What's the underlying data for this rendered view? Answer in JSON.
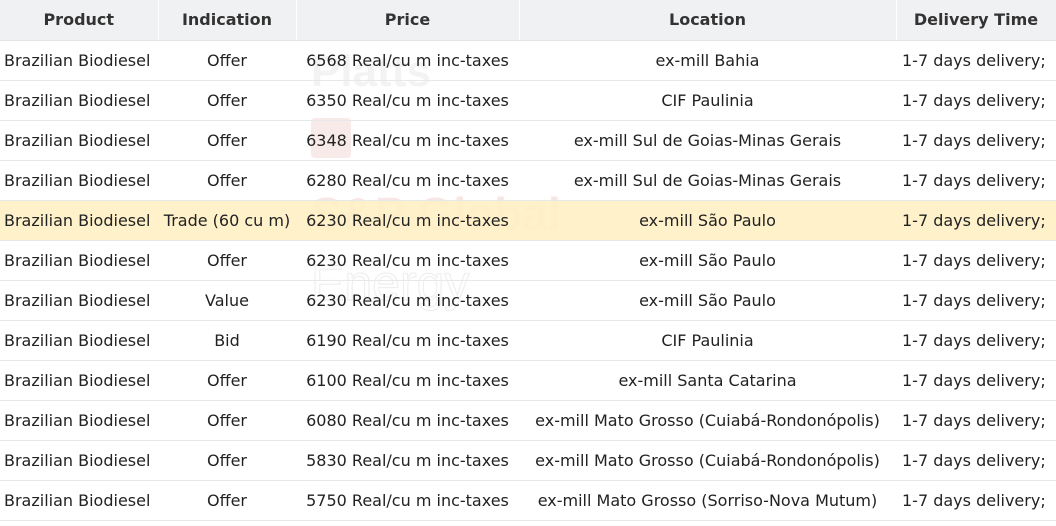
{
  "watermark": {
    "line1": "Platts",
    "line2": "S&P Global",
    "line3": "Energy"
  },
  "colors": {
    "header_bg": "#f0f1f3",
    "highlight_row": "#fff0c4",
    "row_border": "#e6e8ea"
  },
  "table": {
    "headers": [
      "Product",
      "Indication",
      "Price",
      "Location",
      "Delivery Time"
    ],
    "rows": [
      {
        "product": "Brazilian Biodiesel",
        "indication": "Offer",
        "price": "6568 Real/cu m inc-taxes",
        "location": "ex-mill Bahia",
        "delivery": "1-7 days delivery;",
        "highlight": false
      },
      {
        "product": "Brazilian Biodiesel",
        "indication": "Offer",
        "price": "6350 Real/cu m inc-taxes",
        "location": "CIF Paulinia",
        "delivery": "1-7 days delivery;",
        "highlight": false
      },
      {
        "product": "Brazilian Biodiesel",
        "indication": "Offer",
        "price": "6348 Real/cu m inc-taxes",
        "location": "ex-mill Sul de Goias-Minas Gerais",
        "delivery": "1-7 days delivery;",
        "highlight": false
      },
      {
        "product": "Brazilian Biodiesel",
        "indication": "Offer",
        "price": "6280 Real/cu m inc-taxes",
        "location": "ex-mill Sul de Goias-Minas Gerais",
        "delivery": "1-7 days delivery;",
        "highlight": false
      },
      {
        "product": "Brazilian Biodiesel",
        "indication": "Trade (60 cu m)",
        "price": "6230 Real/cu m inc-taxes",
        "location": "ex-mill São Paulo",
        "delivery": "1-7 days delivery;",
        "highlight": true
      },
      {
        "product": "Brazilian Biodiesel",
        "indication": "Offer",
        "price": "6230 Real/cu m inc-taxes",
        "location": "ex-mill São Paulo",
        "delivery": "1-7 days delivery;",
        "highlight": false
      },
      {
        "product": "Brazilian Biodiesel",
        "indication": "Value",
        "price": "6230 Real/cu m inc-taxes",
        "location": "ex-mill São Paulo",
        "delivery": "1-7 days delivery;",
        "highlight": false
      },
      {
        "product": "Brazilian Biodiesel",
        "indication": "Bid",
        "price": "6190 Real/cu m inc-taxes",
        "location": "CIF Paulinia",
        "delivery": "1-7 days delivery;",
        "highlight": false
      },
      {
        "product": "Brazilian Biodiesel",
        "indication": "Offer",
        "price": "6100 Real/cu m inc-taxes",
        "location": "ex-mill Santa Catarina",
        "delivery": "1-7 days delivery;",
        "highlight": false
      },
      {
        "product": "Brazilian Biodiesel",
        "indication": "Offer",
        "price": "6080 Real/cu m inc-taxes",
        "location": "ex-mill Mato Grosso (Cuiabá-Rondonópolis)",
        "delivery": "1-7 days delivery;",
        "highlight": false
      },
      {
        "product": "Brazilian Biodiesel",
        "indication": "Offer",
        "price": "5830 Real/cu m inc-taxes",
        "location": "ex-mill Mato Grosso (Cuiabá-Rondonópolis)",
        "delivery": "1-7 days delivery;",
        "highlight": false
      },
      {
        "product": "Brazilian Biodiesel",
        "indication": "Offer",
        "price": "5750 Real/cu m inc-taxes",
        "location": "ex-mill Mato Grosso (Sorriso-Nova Mutum)",
        "delivery": "1-7 days delivery;",
        "highlight": false
      }
    ]
  }
}
